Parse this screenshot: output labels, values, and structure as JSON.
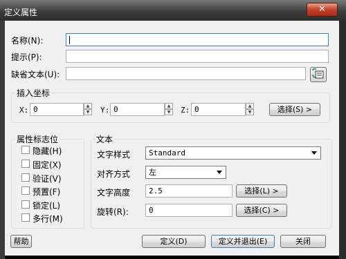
{
  "dialog": {
    "title": "定义属性",
    "close_glyph": "✕"
  },
  "attributes": {
    "name_label": "名称(N):",
    "name_value": "",
    "prompt_label": "提示(P):",
    "prompt_value": "",
    "default_label": "缺省文本(U):",
    "default_value": ""
  },
  "insert_point": {
    "legend": "插入坐标",
    "x_label": "X:",
    "x_value": "0",
    "y_label": "Y:",
    "y_value": "0",
    "z_label": "Z:",
    "z_value": "0",
    "pick_button": "选择(S) >"
  },
  "flags": {
    "legend": "属性标志位",
    "items": [
      {
        "label": "隐藏(H)",
        "checked": false
      },
      {
        "label": "固定(X)",
        "checked": false
      },
      {
        "label": "验证(V)",
        "checked": false
      },
      {
        "label": "预置(F)",
        "checked": false
      },
      {
        "label": "锁定(L)",
        "checked": false
      },
      {
        "label": "多行(M)",
        "checked": false
      }
    ]
  },
  "text": {
    "legend": "文本",
    "style_label": "文字样式",
    "style_value": "Standard",
    "justify_label": "对齐方式",
    "justify_value": "左",
    "height_label": "文字高度",
    "height_value": "2.5",
    "height_button": "选择(L) >",
    "rotation_label": "旋转(R):",
    "rotation_value": "0",
    "rotation_button": "选择(C) >"
  },
  "footer": {
    "help": "帮助",
    "define": "定义(D)",
    "define_exit": "定义并退出(E)",
    "close": "关闭"
  }
}
